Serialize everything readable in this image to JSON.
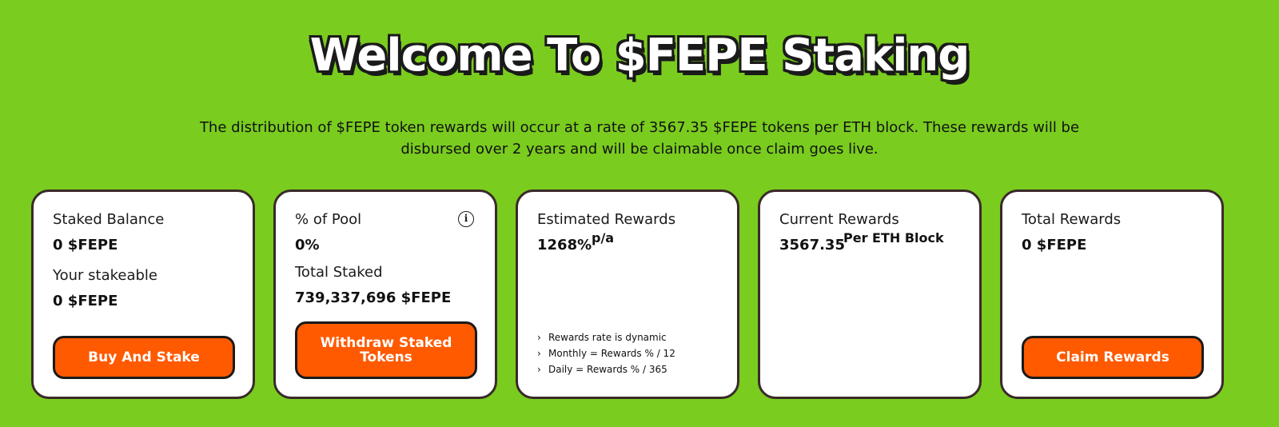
{
  "header": {
    "title": "Welcome To $FEPE Staking",
    "description": "The distribution of $FEPE token rewards will occur at a rate of 3567.35 $FEPE tokens per ETH block. These rewards will be disbursed over 2 years and will be claimable once claim goes live."
  },
  "cards": {
    "staked": {
      "balance_label": "Staked Balance",
      "balance_value": "0 $FEPE",
      "stakeable_label": "Your stakeable",
      "stakeable_value": "0 $FEPE",
      "button_label": "Buy And Stake"
    },
    "pool": {
      "pool_label": "% of Pool",
      "pool_value": "0%",
      "total_label": "Total Staked",
      "total_value": "739,337,696 $FEPE",
      "button_label": "Withdraw Staked Tokens",
      "info_icon": "info-icon"
    },
    "estimated": {
      "label": "Estimated Rewards",
      "value": "1268%",
      "unit": "p/a",
      "notes": [
        "Rewards rate is dynamic",
        "Monthly = Rewards % / 12",
        "Daily = Rewards % / 365"
      ]
    },
    "current": {
      "label": "Current Rewards",
      "value": "3567.35",
      "unit": "Per ETH Block"
    },
    "total": {
      "label": "Total Rewards",
      "value": "0 $FEPE",
      "button_label": "Claim Rewards"
    }
  },
  "colors": {
    "background": "#7ACC1F",
    "button": "#FF5A00",
    "card_border": "#3a2a2a"
  }
}
